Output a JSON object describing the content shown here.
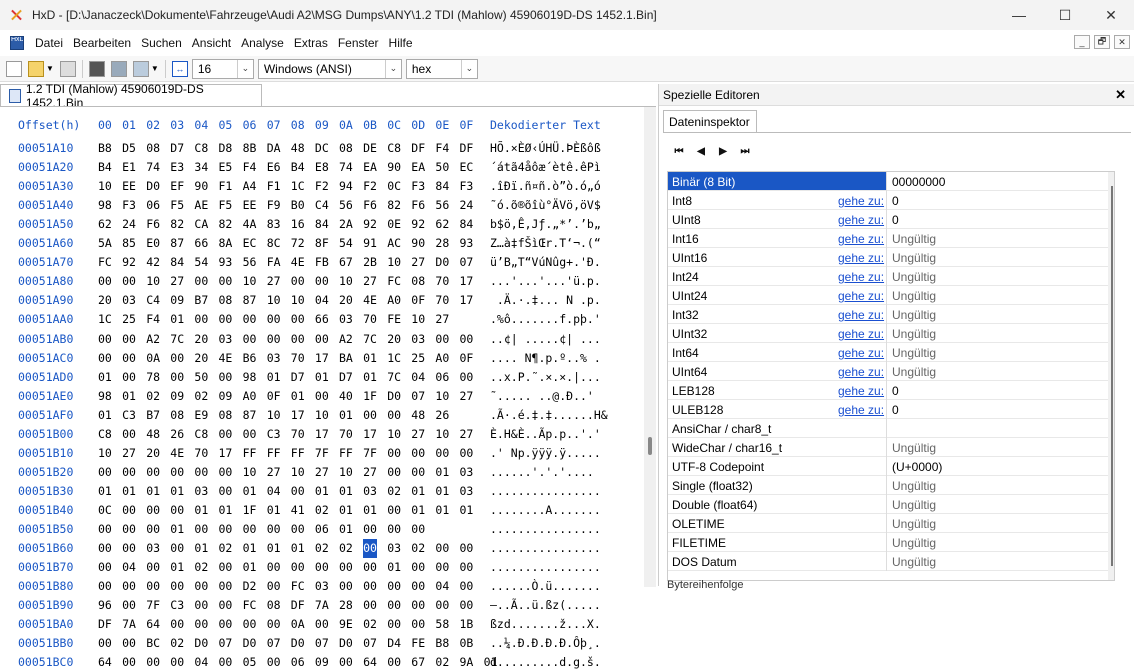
{
  "window": {
    "title": "HxD - [D:\\Janaczeck\\Dokumente\\Fahrzeuge\\Audi A2\\MSG Dumps\\ANY\\1.2 TDI (Mahlow) 45906019D-DS  1452.1.Bin]",
    "minimize": "—",
    "maximize": "☐",
    "close": "✕"
  },
  "menu": {
    "icon": "HxD",
    "items": [
      "Datei",
      "Bearbeiten",
      "Suchen",
      "Ansicht",
      "Analyse",
      "Extras",
      "Fenster",
      "Hilfe"
    ],
    "mdi": [
      "_",
      "🗗",
      "✕"
    ]
  },
  "toolbar": {
    "bytes_per_row": "16",
    "charset": "Windows (ANSI)",
    "mode": "hex"
  },
  "doc_tab": {
    "label": "1.2 TDI (Mahlow) 45906019D-DS  1452.1.Bin"
  },
  "hex": {
    "header": {
      "offset": "Offset(h)",
      "cols": [
        "00",
        "01",
        "02",
        "03",
        "04",
        "05",
        "06",
        "07",
        "08",
        "09",
        "0A",
        "0B",
        "0C",
        "0D",
        "0E",
        "0F"
      ],
      "decoded": "Dekodierter Text"
    },
    "rows": [
      {
        "o": "00051A10",
        "b": [
          "B8",
          "D5",
          "08",
          "D7",
          "C8",
          "D8",
          "8B",
          "DA",
          "48",
          "DC",
          "08",
          "DE",
          "C8",
          "DF",
          "F4",
          "DF"
        ],
        "t": "HÕ.×ÈØ‹ÚHÜ.ÞÈßôß"
      },
      {
        "o": "00051A20",
        "b": [
          "B4",
          "E1",
          "74",
          "E3",
          "34",
          "E5",
          "F4",
          "E6",
          "B4",
          "E8",
          "74",
          "EA",
          "90",
          "EA",
          "50",
          "EC"
        ],
        "t": "´átã4åôæ´ètê.êPì"
      },
      {
        "o": "00051A30",
        "b": [
          "10",
          "EE",
          "D0",
          "EF",
          "90",
          "F1",
          "A4",
          "F1",
          "1C",
          "F2",
          "94",
          "F2",
          "0C",
          "F3",
          "84",
          "F3"
        ],
        "t": ".îÐï.ñ¤ñ.ò”ò.ó„ó"
      },
      {
        "o": "00051A40",
        "b": [
          "98",
          "F3",
          "06",
          "F5",
          "AE",
          "F5",
          "EE",
          "F9",
          "B0",
          "C4",
          "56",
          "F6",
          "82",
          "F6",
          "56",
          "24"
        ],
        "t": "˜ó.õ®õîù°ÄVö‚öV$"
      },
      {
        "o": "00051A50",
        "b": [
          "62",
          "24",
          "F6",
          "82",
          "CA",
          "82",
          "4A",
          "83",
          "16",
          "84",
          "2A",
          "92",
          "0E",
          "92",
          "62",
          "84"
        ],
        "t": "b$ö‚Ê‚Jƒ.„*’.’b„"
      },
      {
        "o": "00051A60",
        "b": [
          "5A",
          "85",
          "E0",
          "87",
          "66",
          "8A",
          "EC",
          "8C",
          "72",
          "8F",
          "54",
          "91",
          "AC",
          "90",
          "28",
          "93"
        ],
        "t": "Z…à‡fŠìŒr.T‘¬.(“"
      },
      {
        "o": "00051A70",
        "b": [
          "FC",
          "92",
          "42",
          "84",
          "54",
          "93",
          "56",
          "FA",
          "4E",
          "FB",
          "67",
          "2B",
          "10",
          "27",
          "D0",
          "07"
        ],
        "t": "ü’B„T“VúNûg+.'Ð."
      },
      {
        "o": "00051A80",
        "b": [
          "00",
          "00",
          "10",
          "27",
          "00",
          "00",
          "10",
          "27",
          "00",
          "00",
          "10",
          "27",
          "FC",
          "08",
          "70",
          "17"
        ],
        "t": "...'...'...'ü.p."
      },
      {
        "o": "00051A90",
        "b": [
          "20",
          "03",
          "C4",
          "09",
          "B7",
          "08",
          "87",
          "10",
          "10",
          "04",
          "20",
          "4E",
          "A0",
          "0F",
          "70",
          "17"
        ],
        "t": " .Ä.·.‡... N .p."
      },
      {
        "o": "00051AA0",
        "b": [
          "1C",
          "25",
          "F4",
          "01",
          "00",
          "00",
          "00",
          "00",
          "00",
          "66",
          "03",
          "70",
          "FE",
          "10",
          "27"
        ],
        "t": ".%ô.......f.pþ.'"
      },
      {
        "o": "00051AB0",
        "b": [
          "00",
          "00",
          "A2",
          "7C",
          "20",
          "03",
          "00",
          "00",
          "00",
          "00",
          "A2",
          "7C",
          "20",
          "03",
          "00",
          "00"
        ],
        "t": "..¢| .....¢| ..."
      },
      {
        "o": "00051AC0",
        "b": [
          "00",
          "00",
          "0A",
          "00",
          "20",
          "4E",
          "B6",
          "03",
          "70",
          "17",
          "BA",
          "01",
          "1C",
          "25",
          "A0",
          "0F"
        ],
        "t": ".... N¶.p.º..% ."
      },
      {
        "o": "00051AD0",
        "b": [
          "01",
          "00",
          "78",
          "00",
          "50",
          "00",
          "98",
          "01",
          "D7",
          "01",
          "D7",
          "01",
          "7C",
          "04",
          "06",
          "00"
        ],
        "t": "..x.P.˜.×.×.|..."
      },
      {
        "o": "00051AE0",
        "b": [
          "98",
          "01",
          "02",
          "09",
          "02",
          "09",
          "A0",
          "0F",
          "01",
          "00",
          "40",
          "1F",
          "D0",
          "07",
          "10",
          "27"
        ],
        "t": "˜..... ..@.Ð..'"
      },
      {
        "o": "00051AF0",
        "b": [
          "01",
          "C3",
          "B7",
          "08",
          "E9",
          "08",
          "87",
          "10",
          "17",
          "10",
          "01",
          "00",
          "00",
          "48",
          "26"
        ],
        "t": ".Ã·.é.‡.‡......H&"
      },
      {
        "o": "00051B00",
        "b": [
          "C8",
          "00",
          "48",
          "26",
          "C8",
          "00",
          "00",
          "C3",
          "70",
          "17",
          "70",
          "17",
          "10",
          "27",
          "10",
          "27"
        ],
        "t": "È.H&È..Ãp.p..'.'"
      },
      {
        "o": "00051B10",
        "b": [
          "10",
          "27",
          "20",
          "4E",
          "70",
          "17",
          "FF",
          "FF",
          "FF",
          "7F",
          "FF",
          "7F",
          "00",
          "00",
          "00",
          "00"
        ],
        "t": ".' Np.ÿÿÿ.ÿ....."
      },
      {
        "o": "00051B20",
        "b": [
          "00",
          "00",
          "00",
          "00",
          "00",
          "00",
          "10",
          "27",
          "10",
          "27",
          "10",
          "27",
          "00",
          "00",
          "01",
          "03"
        ],
        "t": "......'.'.'...."
      },
      {
        "o": "00051B30",
        "b": [
          "01",
          "01",
          "01",
          "01",
          "03",
          "00",
          "01",
          "04",
          "00",
          "01",
          "01",
          "03",
          "02",
          "01",
          "01",
          "03"
        ],
        "t": "................"
      },
      {
        "o": "00051B40",
        "b": [
          "0C",
          "00",
          "00",
          "00",
          "01",
          "01",
          "1F",
          "01",
          "41",
          "02",
          "01",
          "01",
          "00",
          "01",
          "01",
          "01"
        ],
        "t": "........A......."
      },
      {
        "o": "00051B50",
        "b": [
          "00",
          "00",
          "00",
          "01",
          "00",
          "00",
          "00",
          "00",
          "00",
          "06",
          "01",
          "00",
          "00",
          "00"
        ],
        "t": "................"
      },
      {
        "o": "00051B60",
        "b": [
          "00",
          "00",
          "03",
          "00",
          "01",
          "02",
          "01",
          "01",
          "01",
          "02",
          "02",
          "00",
          "03",
          "02",
          "00",
          "00"
        ],
        "t": "................"
      },
      {
        "o": "00051B70",
        "b": [
          "00",
          "04",
          "00",
          "01",
          "02",
          "00",
          "01",
          "00",
          "00",
          "00",
          "00",
          "00",
          "01",
          "00",
          "00",
          "00"
        ],
        "t": "................"
      },
      {
        "o": "00051B80",
        "b": [
          "00",
          "00",
          "00",
          "00",
          "00",
          "00",
          "D2",
          "00",
          "FC",
          "03",
          "00",
          "00",
          "00",
          "00",
          "04",
          "00"
        ],
        "t": "......Ò.ü......."
      },
      {
        "o": "00051B90",
        "b": [
          "96",
          "00",
          "7F",
          "C3",
          "00",
          "00",
          "FC",
          "08",
          "DF",
          "7A",
          "28",
          "00",
          "00",
          "00",
          "00",
          "00"
        ],
        "t": "–..Ã..ü.ßz(....."
      },
      {
        "o": "00051BA0",
        "b": [
          "DF",
          "7A",
          "64",
          "00",
          "00",
          "00",
          "00",
          "00",
          "0A",
          "00",
          "9E",
          "02",
          "00",
          "00",
          "58",
          "1B"
        ],
        "t": "ßzd.......ž...X."
      },
      {
        "o": "00051BB0",
        "b": [
          "00",
          "00",
          "BC",
          "02",
          "D0",
          "07",
          "D0",
          "07",
          "D0",
          "07",
          "D0",
          "07",
          "D4",
          "FE",
          "B8",
          "0B"
        ],
        "t": "..¼.Ð.Ð.Ð.Ð.Ôþ¸."
      },
      {
        "o": "00051BC0",
        "b": [
          "64",
          "00",
          "00",
          "00",
          "04",
          "00",
          "05",
          "00",
          "06",
          "09",
          "00",
          "64",
          "00",
          "67",
          "02",
          "9A",
          "01"
        ],
        "t": "d.........d.g.š."
      }
    ]
  },
  "side": {
    "title": "Spezielle Editoren",
    "close": "✕",
    "tab": "Dateninspektor",
    "nav": [
      "⏮",
      "◀",
      "▶",
      "⏭"
    ],
    "goto": "gehe zu:",
    "rows": [
      {
        "name": "Binär (8 Bit)",
        "val": "00000000",
        "hl": true
      },
      {
        "name": "Int8",
        "val": "0",
        "goto": true
      },
      {
        "name": "UInt8",
        "val": "0",
        "goto": true
      },
      {
        "name": "Int16",
        "val": "Ungültig",
        "goto": true,
        "muted": true
      },
      {
        "name": "UInt16",
        "val": "Ungültig",
        "goto": true,
        "muted": true
      },
      {
        "name": "Int24",
        "val": "Ungültig",
        "goto": true,
        "muted": true
      },
      {
        "name": "UInt24",
        "val": "Ungültig",
        "goto": true,
        "muted": true
      },
      {
        "name": "Int32",
        "val": "Ungültig",
        "goto": true,
        "muted": true
      },
      {
        "name": "UInt32",
        "val": "Ungültig",
        "goto": true,
        "muted": true
      },
      {
        "name": "Int64",
        "val": "Ungültig",
        "goto": true,
        "muted": true
      },
      {
        "name": "UInt64",
        "val": "Ungültig",
        "goto": true,
        "muted": true
      },
      {
        "name": "LEB128",
        "val": "0",
        "goto": true
      },
      {
        "name": "ULEB128",
        "val": "0",
        "goto": true
      },
      {
        "name": "AnsiChar / char8_t",
        "val": ""
      },
      {
        "name": "WideChar / char16_t",
        "val": "Ungültig",
        "muted": true
      },
      {
        "name": "UTF-8 Codepoint",
        "val": "  (U+0000)"
      },
      {
        "name": "Single (float32)",
        "val": "Ungültig",
        "muted": true
      },
      {
        "name": "Double (float64)",
        "val": "Ungültig",
        "muted": true
      },
      {
        "name": "OLETIME",
        "val": "Ungültig",
        "muted": true
      },
      {
        "name": "FILETIME",
        "val": "Ungültig",
        "muted": true
      },
      {
        "name": "DOS Datum",
        "val": "Ungültig",
        "muted": true
      }
    ],
    "byte_order": "Bytereihenfolge"
  }
}
